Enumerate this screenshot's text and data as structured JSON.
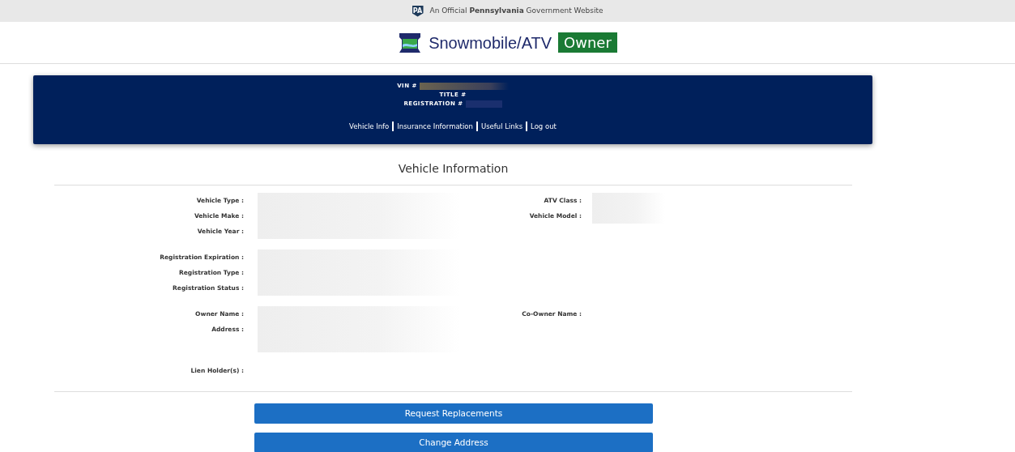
{
  "official_banner": {
    "badge": "PA",
    "text": "An Official **Pennsylvania** Government Website"
  },
  "header": {
    "title": "Snowmobile/ATV",
    "tag": "Owner"
  },
  "summary": {
    "lines": [
      {
        "label": "VIN #",
        "value_hidden": true
      },
      {
        "label": "TITLE #",
        "value_hidden": false
      },
      {
        "label": "REGISTRATION #",
        "value_hidden": true
      }
    ],
    "links": [
      "Vehicle Info",
      "Insurance Information",
      "Useful Links",
      "Log out"
    ]
  },
  "section_title": "Vehicle Information",
  "groups": [
    [
      {
        "label": "Vehicle Type :",
        "value_hidden": true,
        "right_label": "ATV Class :",
        "right_value_hidden": true
      },
      {
        "label": "Vehicle Make :",
        "value_hidden": true,
        "right_label": "Vehicle Model :",
        "right_value_hidden": true
      },
      {
        "label": "Vehicle Year :",
        "value_hidden": true
      }
    ],
    [
      {
        "label": "Registration Expiration :",
        "value_hidden": true
      },
      {
        "label": "Registration Type :",
        "value_hidden": true
      },
      {
        "label": "Registration Status :",
        "value_hidden": true
      }
    ],
    [
      {
        "label": "Owner Name :",
        "value_hidden": true,
        "right_label": "Co-Owner Name :",
        "right_value_hidden": false
      },
      {
        "label": "Address :",
        "value_hidden": true
      },
      {
        "value_hidden": true
      }
    ],
    [
      {
        "label": "Lien Holder(s) :",
        "value_hidden": false
      }
    ]
  ],
  "buttons": [
    "Request Replacements",
    "Change Address"
  ]
}
